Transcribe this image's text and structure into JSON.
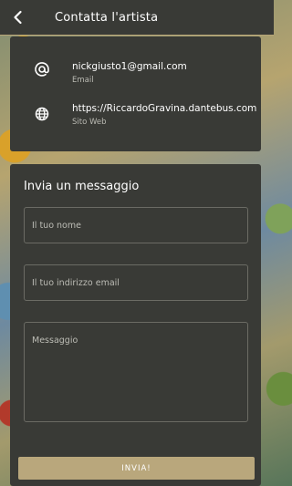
{
  "header": {
    "back_icon": "chevron-left-icon",
    "title": "Contatta l'artista"
  },
  "contacts": [
    {
      "icon": "at-icon",
      "value": "nickgiusto1@gmail.com",
      "label": "Email"
    },
    {
      "icon": "globe-icon",
      "value": "https://RiccardoGravina.dantebus.com",
      "label": "Sito Web"
    }
  ],
  "form": {
    "title": "Invia un messaggio",
    "name_placeholder": "Il tuo nome",
    "email_placeholder": "Il tuo indirizzo email",
    "message_placeholder": "Messaggio",
    "send_label": "INVIA!"
  },
  "colors": {
    "header_bg": "#393a36",
    "card_bg": "#393a36",
    "accent": "#b9a77c"
  }
}
